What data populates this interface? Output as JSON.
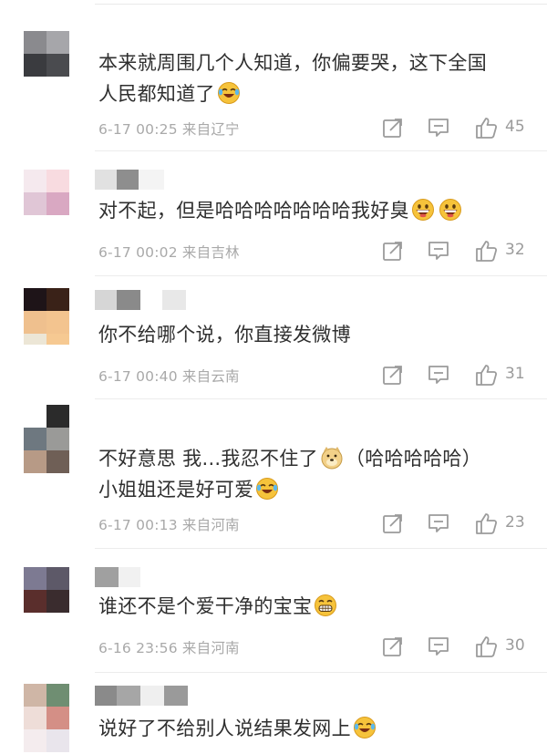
{
  "comments": [
    {
      "text_lines": [
        "本来就周围几个人知道，你偏要哭，这下全国",
        "人民都知道了"
      ],
      "emoji_after": "laugh-cry",
      "time": "6-17 00:25",
      "location": "来自辽宁",
      "likes": "45"
    },
    {
      "text_lines": [
        "对不起，但是哈哈哈哈哈哈哈我好臭"
      ],
      "emoji_after": "grin",
      "time": "6-17 00:02",
      "location": "来自吉林",
      "likes": "32"
    },
    {
      "text_lines": [
        "你不给哪个说，你直接发微博"
      ],
      "emoji_after": "",
      "time": "6-17 00:40",
      "location": "来自云南",
      "likes": "31"
    },
    {
      "text_lines": [
        "不好意思 我...我忍不住了",
        "（哈哈哈哈哈）",
        "小姐姐还是好可爱"
      ],
      "emoji_after": "laugh-cry",
      "time": "6-17 00:13",
      "location": "来自河南",
      "likes": "23"
    },
    {
      "text_lines": [
        "谁还不是个爱干净的宝宝"
      ],
      "emoji_after": "teeth-grin",
      "time": "6-16 23:56",
      "location": "来自河南",
      "likes": "30"
    },
    {
      "text_lines": [
        "说好了不给别人说结果发网上"
      ],
      "emoji_after": "laugh-cry",
      "time": "",
      "location": "",
      "likes": ""
    }
  ],
  "icons": {
    "share": "share-icon",
    "reply": "comment-icon",
    "like": "thumbs-up-icon",
    "emoji_laugh_cry": "laugh-cry-emoji-icon",
    "emoji_grin": "grin-emoji-icon",
    "emoji_doge": "doge-emoji-icon",
    "emoji_teeth": "teeth-grin-emoji-icon"
  },
  "colors": {
    "text": "#2f2f2f",
    "meta": "#a9a9a9",
    "icon": "#9b9b9b",
    "divider": "#ececec",
    "emoji_yellow": "#f6c33b"
  }
}
